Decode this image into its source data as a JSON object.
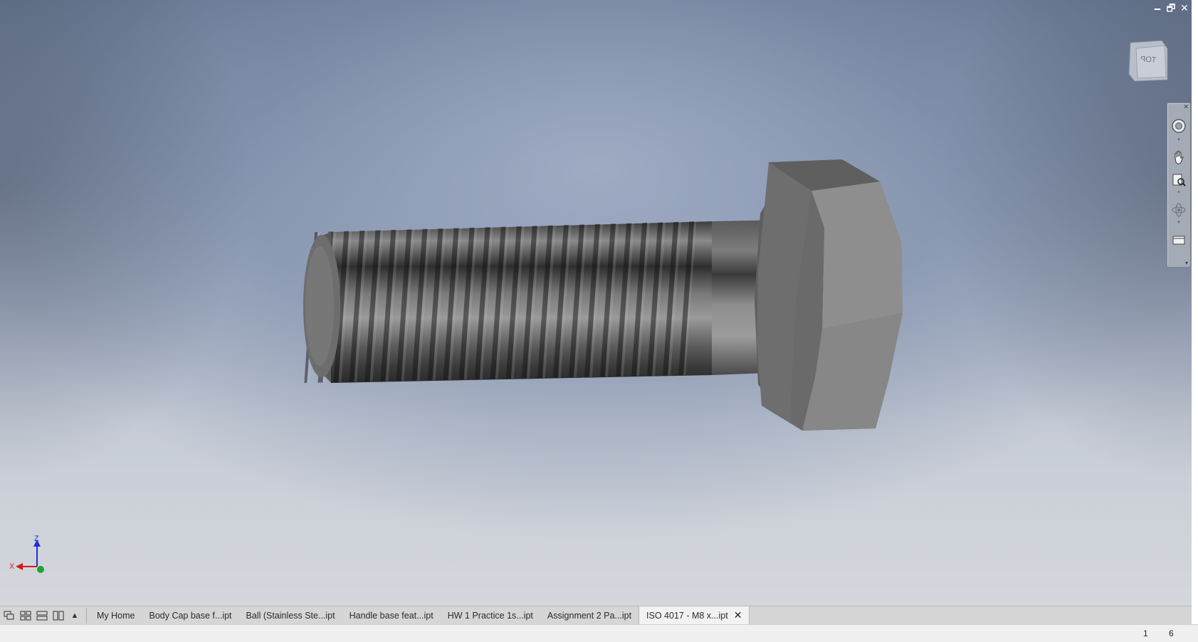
{
  "window_controls": {
    "minimize": "🗕",
    "restore": "🗗",
    "close": "✕"
  },
  "view_cube": {
    "face_label": "TOP"
  },
  "navigation_bar": {
    "tools": [
      "steering-wheel-icon",
      "pan-hand-icon",
      "zoom-window-icon",
      "orbit-icon",
      "look-at-icon"
    ]
  },
  "axis_triad": {
    "x_label": "X",
    "z_label": "Z",
    "x_color": "#d11b1b",
    "z_color": "#1e2fd6",
    "y_color": "#18a635"
  },
  "tabbar": {
    "overflow_label": "▲",
    "tabs": [
      {
        "label": "My Home"
      },
      {
        "label": "Body Cap base f...ipt"
      },
      {
        "label": "Ball (Stainless Ste...ipt"
      },
      {
        "label": "Handle base feat...ipt"
      },
      {
        "label": "HW 1 Practice 1s...ipt"
      },
      {
        "label": "Assignment 2 Pa...ipt"
      },
      {
        "label": "ISO 4017 - M8 x...ipt"
      }
    ],
    "active_tab_close": "✕"
  },
  "statusbar": {
    "value_1": "1",
    "value_2": "6"
  }
}
